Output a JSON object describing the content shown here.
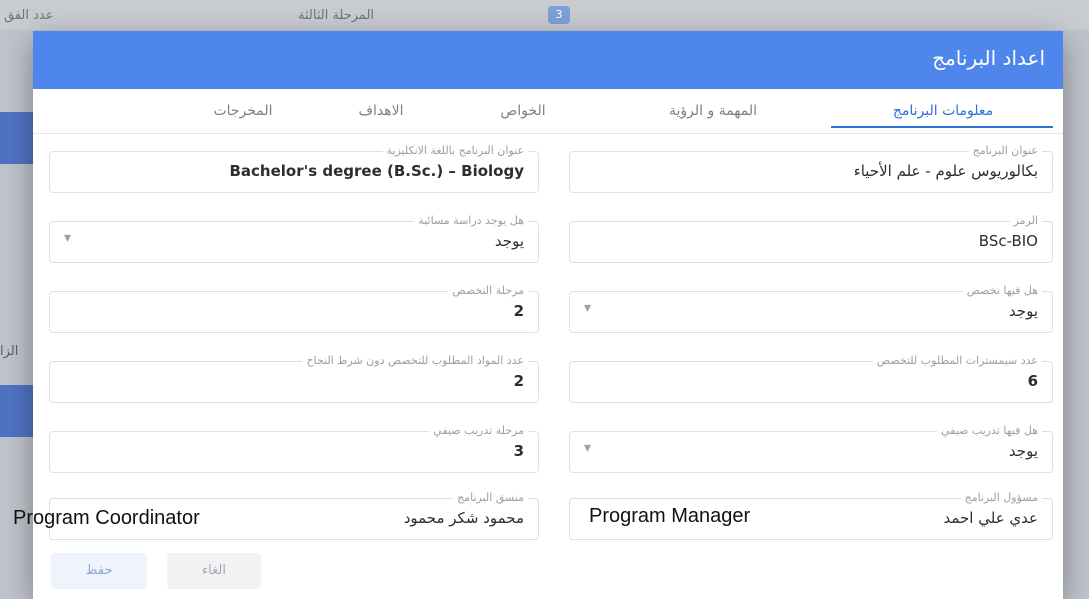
{
  "background": {
    "top_left_text": "عدد الفق",
    "top_mid_text": "المرحلة الثالثة",
    "top_badge": "3",
    "left_mid_text": "الزا"
  },
  "dialog": {
    "title": "اعداد البرنامج",
    "header_color": "#4f86ec",
    "accent_color": "#2f6fd8"
  },
  "tabs": [
    {
      "label": "معلومات البرنامج",
      "active": true
    },
    {
      "label": "المهمة و الرؤية",
      "active": false
    },
    {
      "label": "الخواص",
      "active": false
    },
    {
      "label": "الاهداف",
      "active": false
    },
    {
      "label": "المخرجات",
      "active": false
    }
  ],
  "fields": {
    "program_name": {
      "label": "عنوان البرنامج",
      "value": "بكالوريوس علوم - علم الأحياء"
    },
    "program_name_en": {
      "label": "عنوان البرنامج باللغة الانكليزية",
      "value": "Bachelor's degree (B.Sc.) – Biology"
    },
    "code": {
      "label": "الرمز",
      "value": "BSc-BIO"
    },
    "evening_study": {
      "label": "هل يوجد دراسة مسائية",
      "value": "يوجد",
      "icon": "chevron-down-icon"
    },
    "has_specialization": {
      "label": "هل فيها تخصص",
      "value": "يوجد",
      "icon": "chevron-down-icon"
    },
    "specialization_stage": {
      "label": "مرحلة التخصص",
      "value": "2"
    },
    "specialization_semesters": {
      "label": "عدد سيمسترات المطلوب للتخصص",
      "value": "6"
    },
    "courses_without_pass": {
      "label": "عدد المواد المطلوب للتخصص دون شرط النجاح",
      "value": "2"
    },
    "has_summer_training": {
      "label": "هل فيها تدريب صيفي",
      "value": "يوجد",
      "icon": "chevron-down-icon"
    },
    "summer_training_stage": {
      "label": "مرحلة تدريب صيفي",
      "value": "3"
    },
    "program_manager": {
      "label": "مسؤول البرنامج",
      "value": "عدي علي احمد",
      "caption": "Program Manager"
    },
    "program_coordinator": {
      "label": "منسق البرنامج",
      "value": "محمود شكر محمود",
      "caption": "Program Coordinator"
    }
  },
  "buttons": {
    "save_label": "حفظ",
    "cancel_label": "الغاء"
  }
}
